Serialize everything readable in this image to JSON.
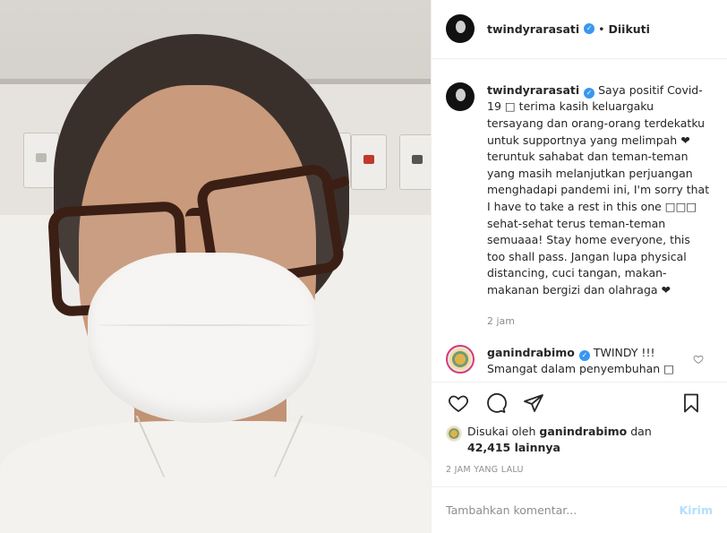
{
  "header": {
    "username": "twindyrarasati",
    "verified_glyph": "✓",
    "separator": "•",
    "follow_status": "Diikuti"
  },
  "caption": {
    "username": "twindyrarasati",
    "text": "Saya positif Covid-19 □ terima kasih keluargaku tersayang dan orang-orang terdekatku untuk supportnya yang melimpah ❤ teruntuk sahabat dan teman-teman yang masih melanjutkan perjuangan menghadapi pandemi ini, I'm sorry that I have to take a rest in this one □□□ sehat-sehat terus teman-teman semuaaa! Stay home everyone, this too shall pass. Jangan lupa physical distancing, cuci tangan, makan-makanan bergizi dan olahraga ❤",
    "time": "2 jam"
  },
  "comment": {
    "username": "ganindrabimo",
    "line1": "TWINDY !!!",
    "line2": "Smangat dalam penyembuhan □"
  },
  "likes": {
    "prefix": "Disukai oleh",
    "user": "ganindrabimo",
    "middle": "dan",
    "count": "42,415 lainnya"
  },
  "post_age": "2 JAM YANG LALU",
  "add_comment": {
    "placeholder": "Tambahkan komentar...",
    "post_label": "Kirim"
  },
  "icons": [
    "heart-icon",
    "comment-icon",
    "share-icon",
    "bookmark-icon",
    "verified-badge-icon"
  ],
  "colors": {
    "accent": "#3897f0",
    "muted": "#8e8e8e",
    "post_disabled": "#b2dffc"
  }
}
